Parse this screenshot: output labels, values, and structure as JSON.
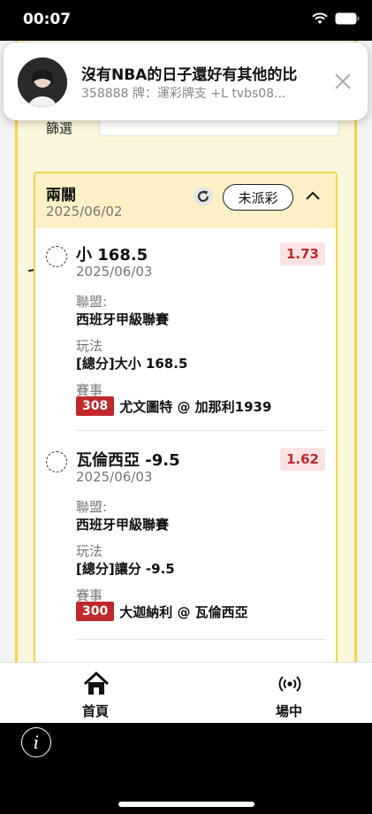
{
  "status_bar": {
    "time": "00:07"
  },
  "notification": {
    "title": "沒有NBA的日子還好有其他的比",
    "subtitle": "358888 牌：運彩牌支 +L  tvbs08..."
  },
  "filter": {
    "label": "篩選"
  },
  "parlay": {
    "title": "兩關",
    "date": "2025/06/02",
    "status": "未派彩",
    "bets": [
      {
        "title": "小 168.5",
        "date": "2025/06/03",
        "odds": "1.73",
        "league_label": "聯盟:",
        "league": "西班牙甲級聯賽",
        "play_label": "玩法",
        "play": "[總分]大小 168.5",
        "event_label": "賽事",
        "event_num": "308",
        "event": "尤文圖特 @ 加那利1939"
      },
      {
        "title": "瓦倫西亞 -9.5",
        "date": "2025/06/03",
        "odds": "1.62",
        "league_label": "聯盟:",
        "league": "西班牙甲級聯賽",
        "play_label": "玩法",
        "play": "[總分]讓分 -9.5",
        "event_label": "賽事",
        "event_num": "300",
        "event": "大迦納利 @ 瓦倫西亞"
      }
    ]
  },
  "tabs": [
    {
      "label": "首頁",
      "icon": "home-icon"
    },
    {
      "label": "場中",
      "icon": "live-broadcast-icon"
    }
  ],
  "info_button": "i"
}
